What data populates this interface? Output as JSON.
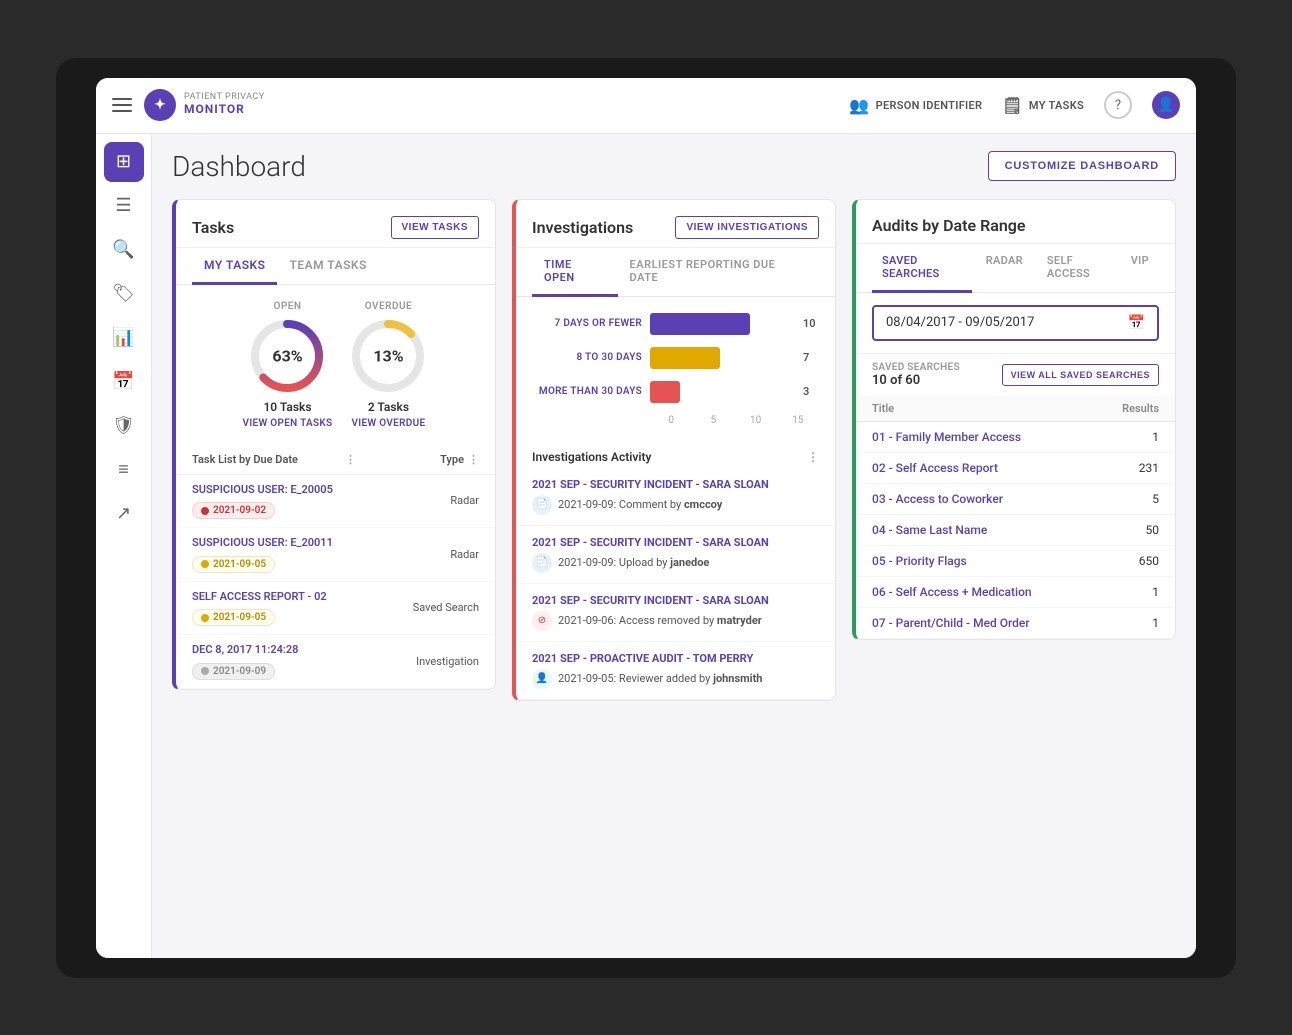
{
  "app": {
    "logo_top": "PATIENT PRIVACY",
    "logo_bottom": "MONITOR",
    "logo_symbol": "✦"
  },
  "top_nav": {
    "person_identifier": "PERSON IDENTIFIER",
    "my_tasks": "MY TASKS",
    "hamburger_title": "Menu"
  },
  "sidebar": {
    "items": [
      {
        "name": "dashboard",
        "icon": "⊞",
        "active": true
      },
      {
        "name": "tasks",
        "icon": "☰",
        "active": false
      },
      {
        "name": "search",
        "icon": "🔍",
        "active": false
      },
      {
        "name": "tag",
        "icon": "🏷",
        "active": false
      },
      {
        "name": "chart-bar",
        "icon": "📊",
        "active": false
      },
      {
        "name": "calendar",
        "icon": "📅",
        "active": false
      },
      {
        "name": "shield",
        "icon": "🛡",
        "active": false
      },
      {
        "name": "list",
        "icon": "≡",
        "active": false
      },
      {
        "name": "trending",
        "icon": "↗",
        "active": false
      }
    ]
  },
  "header": {
    "title": "Dashboard",
    "customize_btn": "CUSTOMIZE DASHBOARD"
  },
  "tasks_panel": {
    "title": "Tasks",
    "view_btn": "VIEW TASKS",
    "tabs": [
      "MY TASKS",
      "TEAM TASKS"
    ],
    "active_tab": 0,
    "open_label": "OPEN",
    "overdue_label": "OVERDUE",
    "open_pct": "63%",
    "overdue_pct": "13%",
    "open_tasks": "10 Tasks",
    "overdue_tasks": "2 Tasks",
    "view_open_link": "VIEW OPEN TASKS",
    "view_overdue_link": "VIEW OVERDUE",
    "list_header_task": "Task List by Due Date",
    "list_header_type": "Type",
    "task_rows": [
      {
        "name": "SUSPICIOUS USER: E_20005",
        "date": "2021-09-02",
        "date_color": "red",
        "type": "Radar"
      },
      {
        "name": "SUSPICIOUS USER: E_20011",
        "date": "2021-09-05",
        "date_color": "yellow",
        "type": "Radar"
      },
      {
        "name": "SELF ACCESS REPORT - 02",
        "date": "2021-09-05",
        "date_color": "yellow",
        "type": "Saved Search"
      },
      {
        "name": "DEC 8, 2017 11:24:28",
        "date": "2021-09-09",
        "date_color": "gray",
        "type": "Investigation"
      }
    ]
  },
  "investigations_panel": {
    "title": "Investigations",
    "view_btn": "VIEW INVESTIGATIONS",
    "tabs": [
      "TIME OPEN",
      "EARLIEST REPORTING DUE DATE"
    ],
    "active_tab": 0,
    "bars": [
      {
        "label": "7 DAYS OR FEWER",
        "value": 10,
        "max": 15,
        "color": "#5b3fb5",
        "pct": 67
      },
      {
        "label": "8 TO 30 DAYS",
        "value": 7,
        "max": 15,
        "color": "#e0a800",
        "pct": 47
      },
      {
        "label": "MORE THAN 30 DAYS",
        "value": 3,
        "max": 15,
        "color": "#e55353",
        "pct": 20
      }
    ],
    "axis_labels": [
      "0",
      "5",
      "10",
      "15"
    ],
    "activity_header": "Investigations Activity",
    "activity_items": [
      {
        "title": "2021 SEP - SECURITY INCIDENT - SARA SLOAN",
        "date": "2021-09-09:",
        "action": "Comment by",
        "user": "cmccoy",
        "icon_type": "blue",
        "icon": "📄"
      },
      {
        "title": "2021 SEP - SECURITY INCIDENT - SARA SLOAN",
        "date": "2021-09-09:",
        "action": "Upload by",
        "user": "janedoe",
        "icon_type": "blue",
        "icon": "📄"
      },
      {
        "title": "2021 SEP - SECURITY INCIDENT - SARA SLOAN",
        "date": "2021-09-06:",
        "action": "Access removed by",
        "user": "matryder",
        "icon_type": "red",
        "icon": "⊘"
      },
      {
        "title": "2021 SEP - PROACTIVE AUDIT - TOM PERRY",
        "date": "2021-09-05:",
        "action": "Reviewer added by",
        "user": "johnsmith",
        "icon_type": "green",
        "icon": "👤"
      }
    ]
  },
  "audits_panel": {
    "title": "Audits by Date Range",
    "tabs": [
      "SAVED SEARCHES",
      "RADAR",
      "SELF ACCESS",
      "VIP"
    ],
    "active_tab": 0,
    "date_range": "08/04/2017 - 09/05/2017",
    "saved_searches_label": "SAVED SEARCHES",
    "saved_count": "10 of 60",
    "view_all_btn": "VIEW ALL SAVED SEARCHES",
    "table_headers": [
      "Title",
      "Results"
    ],
    "rows": [
      {
        "title": "01 - Family Member Access",
        "results": "1"
      },
      {
        "title": "02 - Self Access Report",
        "results": "231"
      },
      {
        "title": "03 - Access to Coworker",
        "results": "5"
      },
      {
        "title": "04 - Same Last Name",
        "results": "50"
      },
      {
        "title": "05 - Priority Flags",
        "results": "650"
      },
      {
        "title": "06 - Self Access + Medication",
        "results": "1"
      },
      {
        "title": "07 - Parent/Child - Med Order",
        "results": "1"
      }
    ]
  }
}
